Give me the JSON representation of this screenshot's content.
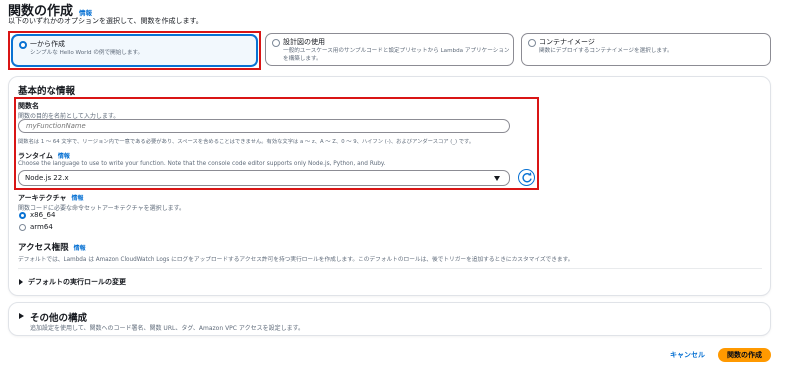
{
  "page": {
    "title": "関数の作成",
    "info_label": "情報",
    "description": "以下のいずれかのオプションを選択して、関数を作成します。"
  },
  "options": [
    {
      "title": "一から作成",
      "description": "シンプルな Hello World の例で開始します。",
      "selected": true
    },
    {
      "title": "設計図の使用",
      "description_line1": "一般的ユースケース用のサンプルコードと設定プリセットから Lambda アプリケーション",
      "description_line2": "を構築します。",
      "selected": false
    },
    {
      "title": "コンテナイメージ",
      "description": "関数にデプロイするコンテナイメージを選択します。",
      "selected": false
    }
  ],
  "basic_info": {
    "title": "基本的な情報",
    "function_name": {
      "label": "関数名",
      "description": "関数の目的を名前として入力します。",
      "value": "",
      "placeholder": "myFunctionName",
      "constraint": "関数名は 1 ～ 64 文字で、リージョン内で一意である必要があり、スペースを含めることはできません。有効な文字は a ～ z、A ～ Z、0 ～ 9、ハイフン (-)、およびアンダースコア (_) です。"
    },
    "runtime": {
      "label": "ランタイム",
      "info_label": "情報",
      "description": "Choose the language to use to write your function. Note that the console code editor supports only Node.js, Python, and Ruby.",
      "selected": "Node.js 22.x",
      "refresh_icon": "refresh-icon"
    },
    "architecture": {
      "label": "アーキテクチャ",
      "info_label": "情報",
      "description": "関数コードに必要な命令セットアーキテクチャを選択します。",
      "options": [
        {
          "label": "x86_64",
          "selected": true
        },
        {
          "label": "arm64",
          "selected": false
        }
      ]
    },
    "permissions": {
      "label": "アクセス権限",
      "info_label": "情報",
      "description": "デフォルトでは、Lambda は Amazon CloudWatch Logs にログをアップロードするアクセス許可を持つ実行ロールを作成します。このデフォルトのロールは、後でトリガーを追加するときにカスタマイズできます。"
    },
    "default_role_expander": "デフォルトの実行ロールの変更"
  },
  "other_config": {
    "title": "その他の構成",
    "description": "追加設定を使用して、関数へのコード署名、関数 URL、タグ、Amazon VPC アクセスを設定します。"
  },
  "footer": {
    "cancel_label": "キャンセル",
    "create_label": "関数の作成"
  },
  "colors": {
    "accent": "#0972d3",
    "primary_button": "#ff9900",
    "highlight": "#d91515"
  }
}
